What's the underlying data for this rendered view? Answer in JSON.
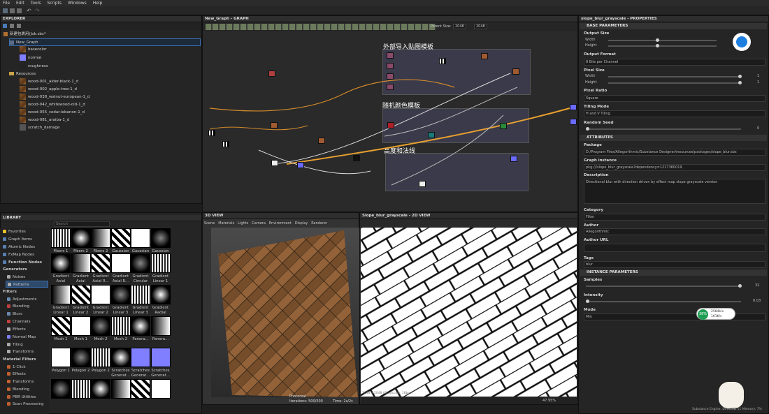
{
  "menu": [
    "File",
    "Edit",
    "Tools",
    "Scripts",
    "Windows",
    "Help"
  ],
  "explorer": {
    "title": "EXPLORER",
    "file": "新建包裹用(Jok.sbs*",
    "graph": "New_Graph",
    "outputs": [
      "basecolor",
      "normal",
      "roughness"
    ],
    "resources_label": "Resources",
    "resources": [
      "wood-001_alder-black-1_d",
      "wood-002_apple-tree-1_d",
      "wood-038_walnut-european-1_d",
      "wood-042_whitewood-old-1_d",
      "wood-055_cedar-lebanon-1_d",
      "wood-081_araiba-1_d",
      "scratch_damage"
    ]
  },
  "graph": {
    "title": "New_Graph - GRAPH",
    "parent_size_label": "Parent Size:",
    "size_a": "2048",
    "size_b": "2048",
    "frames": [
      "外部导入贴图模板",
      "随机颜色模板",
      "高度和法线"
    ]
  },
  "properties": {
    "title": "slope_blur_grayscale - PROPERTIES",
    "base_params": "BASE PARAMETERS",
    "output_size": "Output Size",
    "width": "Width",
    "height": "Height",
    "output_format": "Output Format",
    "format_value": "8 Bits per Channel",
    "pixel_size": "Pixel Size",
    "px_w_val": "1",
    "px_h_val": "1",
    "pixel_ratio": "Pixel Ratio",
    "ratio_value": "Square",
    "tiling_mode": "Tiling Mode",
    "tiling_value": "H and V Tiling",
    "random_seed": "Random Seed",
    "seed_val": "0",
    "attributes": "ATTRIBUTES",
    "package": "Package",
    "package_path": "D:/Program Files/Allegorithmic/Substance Designer/resources/packages/slope_blur.sbs",
    "graph_instance": "Graph instance",
    "graph_instance_val": "pkg:///slope_blur_grayscale?dependency=1217360019",
    "description": "Description",
    "description_val": "Directional blur with direction driven by effect map slope grayscale version",
    "category": "Category",
    "category_val": "Filter",
    "author": "Author",
    "author_val": "Allegorithmic",
    "author_url": "Author URL",
    "tags": "Tags",
    "tags_val": "blur",
    "instance_params": "INSTANCE PARAMETERS",
    "samples": "Samples",
    "samples_val": "32",
    "intensity": "Intensity",
    "intensity_val": "0.03",
    "mode": "Mode",
    "mode_val": "Min",
    "net_pct": "36%",
    "net_up": "2584k/s",
    "net_down": "161K/s",
    "footer": "Substance Engine: Direct3D 11 Memory: 7%"
  },
  "library": {
    "title": "LIBRARY",
    "search_placeholder": "Search",
    "categories": [
      "Favorites",
      "Graph Items",
      "Atomic Nodes",
      "FxMap Nodes",
      "Function Nodes",
      "Generators",
      "Noises",
      "Patterns",
      "Filters",
      "Adjustments",
      "Blending",
      "Blurs",
      "Channels",
      "Effects",
      "Normal Map",
      "Tiling",
      "Transforms",
      "Material Filters",
      "1-Click",
      "Effects",
      "Transforms",
      "Blending",
      "PBR Utilities",
      "Scan Processing"
    ],
    "tiles": [
      [
        "Fibers 1",
        "Fibers 2",
        "Fibers 2",
        "Gaussian 1",
        "Gaussian 1",
        "Gaussian 2"
      ],
      [
        "Gradient Axial",
        "Gradient Axial",
        "Gradient Axial R...",
        "Gradient Axial R...",
        "Gradient Circular",
        "Gradient Linear 1"
      ],
      [
        "Gradient Linear 1",
        "Gradient Linear 2",
        "Gradient Linear 2",
        "Gradient Linear 3",
        "Gradient Linear 3",
        "Gradient Radial"
      ],
      [
        "Mesh 1",
        "Mesh 1",
        "Mesh 2",
        "Mesh 2",
        "Panora...",
        "Panora..."
      ],
      [
        "Polygon 1",
        "Polygon 2",
        "Polygon 2",
        "Scratches Generat...",
        "Scratches Generat...",
        "Scratches Generat..."
      ],
      [
        "",
        "",
        "",
        "",
        "",
        ""
      ]
    ],
    "extra_labels": [
      "Gaussian 2",
      "Gradient Linear 1",
      "Gradient Radial",
      "Polygon 1"
    ]
  },
  "view3d": {
    "title": "3D VIEW",
    "menu": [
      "Scene",
      "Materials",
      "Lights",
      "Camera",
      "Environment",
      "Display",
      "Renderer"
    ],
    "render_label": "Photoreal",
    "iterations": "Iterations: 500/500",
    "time": "Time: 2s/2s"
  },
  "view2d": {
    "title": "Slope_blur_grayscale - 2D VIEW",
    "info": "2048 x 2048 (Grayscale, 16bpc)",
    "zoom": "47.95%"
  }
}
